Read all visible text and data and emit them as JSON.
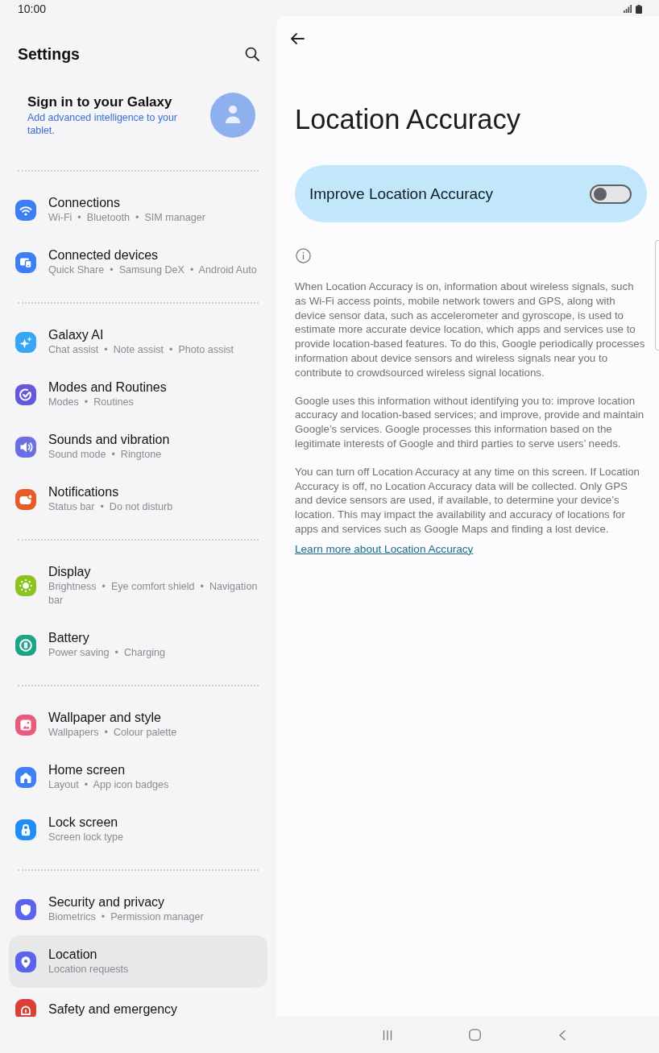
{
  "status_bar": {
    "time": "10:00"
  },
  "sidebar": {
    "title": "Settings",
    "account": {
      "title": "Sign in to your Galaxy",
      "subtitle": "Add advanced intelligence to your tablet."
    },
    "groups": [
      {
        "items": [
          {
            "title": "Connections",
            "subtitle": "Wi-Fi  •  Bluetooth  •  SIM manager",
            "color": "#3c7ef5",
            "selected": false
          },
          {
            "title": "Connected devices",
            "subtitle": "Quick Share  •  Samsung DeX  •  Android Auto",
            "color": "#3c7ef5",
            "selected": false
          }
        ]
      },
      {
        "items": [
          {
            "title": "Galaxy AI",
            "subtitle": "Chat assist  •  Note assist  •  Photo assist",
            "color": "#38a6f4",
            "selected": false
          },
          {
            "title": "Modes and Routines",
            "subtitle": "Modes  •  Routines",
            "color": "#6459dd",
            "selected": false
          },
          {
            "title": "Sounds and vibration",
            "subtitle": "Sound mode  •  Ringtone",
            "color": "#6c6fe4",
            "selected": false
          },
          {
            "title": "Notifications",
            "subtitle": "Status bar  •  Do not disturb",
            "color": "#e85a26",
            "selected": false
          }
        ]
      },
      {
        "items": [
          {
            "title": "Display",
            "subtitle": "Brightness  •  Eye comfort shield  •  Navigation bar",
            "color": "#8cc31e",
            "selected": false
          },
          {
            "title": "Battery",
            "subtitle": "Power saving  •  Charging",
            "color": "#1aa58a",
            "selected": false
          }
        ]
      },
      {
        "items": [
          {
            "title": "Wallpaper and style",
            "subtitle": "Wallpapers  •  Colour palette",
            "color": "#e95c7e",
            "selected": false
          },
          {
            "title": "Home screen",
            "subtitle": "Layout  •  App icon badges",
            "color": "#3d7ff4",
            "selected": false
          },
          {
            "title": "Lock screen",
            "subtitle": "Screen lock type",
            "color": "#1e8ef6",
            "selected": false
          }
        ]
      },
      {
        "items": [
          {
            "title": "Security and privacy",
            "subtitle": "Biometrics  •  Permission manager",
            "color": "#5b63ee",
            "selected": false
          },
          {
            "title": "Location",
            "subtitle": "Location requests",
            "color": "#5b63ee",
            "selected": true
          },
          {
            "title": "Safety and emergency",
            "color": "#dc3f33",
            "selected": false
          }
        ]
      }
    ]
  },
  "detail": {
    "title": "Location Accuracy",
    "toggle": {
      "label": "Improve Location Accuracy",
      "on": false
    },
    "paragraphs": [
      "When Location Accuracy is on, information about wireless signals, such as Wi-Fi access points, mobile network towers and GPS, along with device sensor data, such as accelerometer and gyroscope, is used to estimate more accurate device location, which apps and services use to provide location-based features. To do this, Google periodically processes information about device sensors and wireless signals near you to contribute to crowdsourced wireless signal locations.",
      "Google uses this information without identifying you to: improve location accuracy and location-based services; and improve, provide and maintain Google’s services. Google processes this information based on the legitimate interests of Google and third parties to serve users’ needs.",
      "You can turn off Location Accuracy at any time on this screen. If Location Accuracy is off, no Location Accuracy data will be collected. Only GPS and device sensors are used, if available, to determine your device’s location. This may impact the availability and accuracy of locations for apps and services such as Google Maps and finding a lost device."
    ],
    "link": "Learn more about Location Accuracy"
  }
}
